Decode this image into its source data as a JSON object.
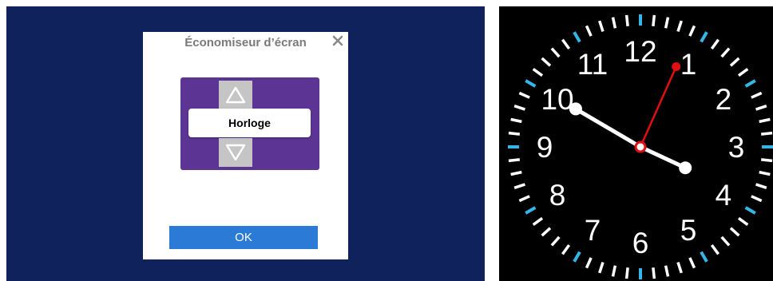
{
  "dialog": {
    "title": "Économiseur d’écran",
    "close_icon": "close-icon",
    "picker": {
      "selected": "Horloge",
      "up_icon": "arrow-up-icon",
      "down_icon": "arrow-down-icon"
    },
    "ok_label": "OK"
  },
  "clock": {
    "numbers": [
      "12",
      "1",
      "2",
      "3",
      "4",
      "5",
      "6",
      "7",
      "8",
      "9",
      "10",
      "11"
    ],
    "time": {
      "hours": 3,
      "minutes": 50,
      "seconds": 4
    },
    "colors": {
      "background": "#000000",
      "ticks": "#ffffff",
      "accent_ticks": "#35b6e6",
      "hands": "#ffffff",
      "second_hand": "#e01010"
    }
  },
  "colors": {
    "panel_background": "#10225c",
    "picker_background": "#5c3594",
    "ok_button": "#2b7bd6"
  }
}
